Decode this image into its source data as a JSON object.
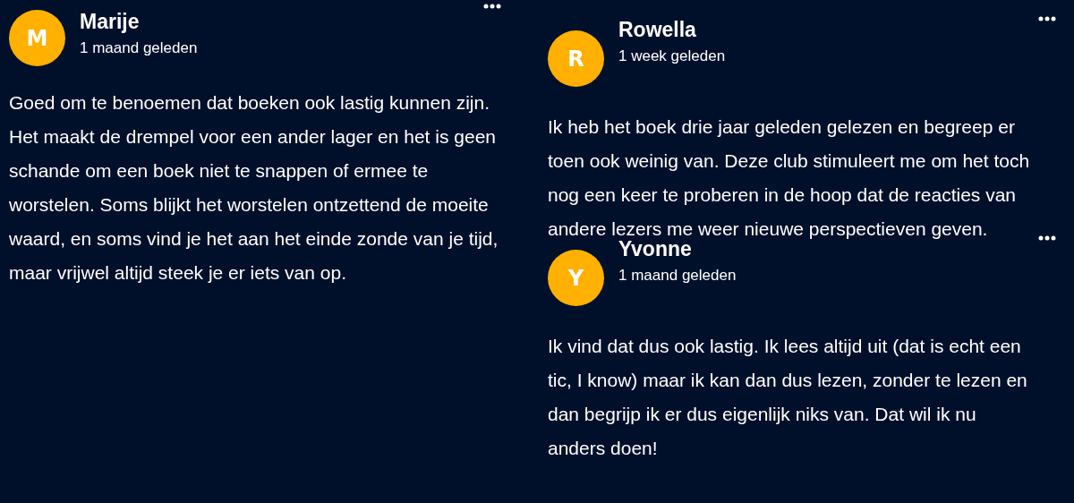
{
  "columns": [
    {
      "comments": [
        {
          "initial": "M",
          "author": "Marije",
          "time": "1 maand geleden",
          "text": "Goed om te benoemen dat boeken ook lastig kunnen zijn. Het maakt de drempel voor een ander lager en het is geen schande om een boek niet te snappen of ermee te worstelen. Soms blijkt het worstelen ontzettend de moeite waard, en soms vind je het aan het einde zonde van je tijd, maar vrijwel altijd steek je er iets van op."
        }
      ]
    },
    {
      "comments": [
        {
          "initial": "R",
          "author": "Rowella",
          "time": "1 week geleden",
          "text": "Ik heb het boek drie jaar geleden gelezen en begreep er toen ook weinig van.  Deze club stimuleert me om het toch nog een keer te proberen in de hoop dat de reacties van andere lezers me weer nieuwe perspectieven geven."
        },
        {
          "initial": "Y",
          "author": "Yvonne",
          "time": "1 maand geleden",
          "text": "Ik vind dat dus ook lastig. Ik lees altijd uit (dat is echt een tic, I know) maar ik kan dan dus lezen, zonder te lezen en dan begrijp ik er dus eigenlijk niks van. Dat wil ik nu anders doen!"
        }
      ]
    }
  ]
}
